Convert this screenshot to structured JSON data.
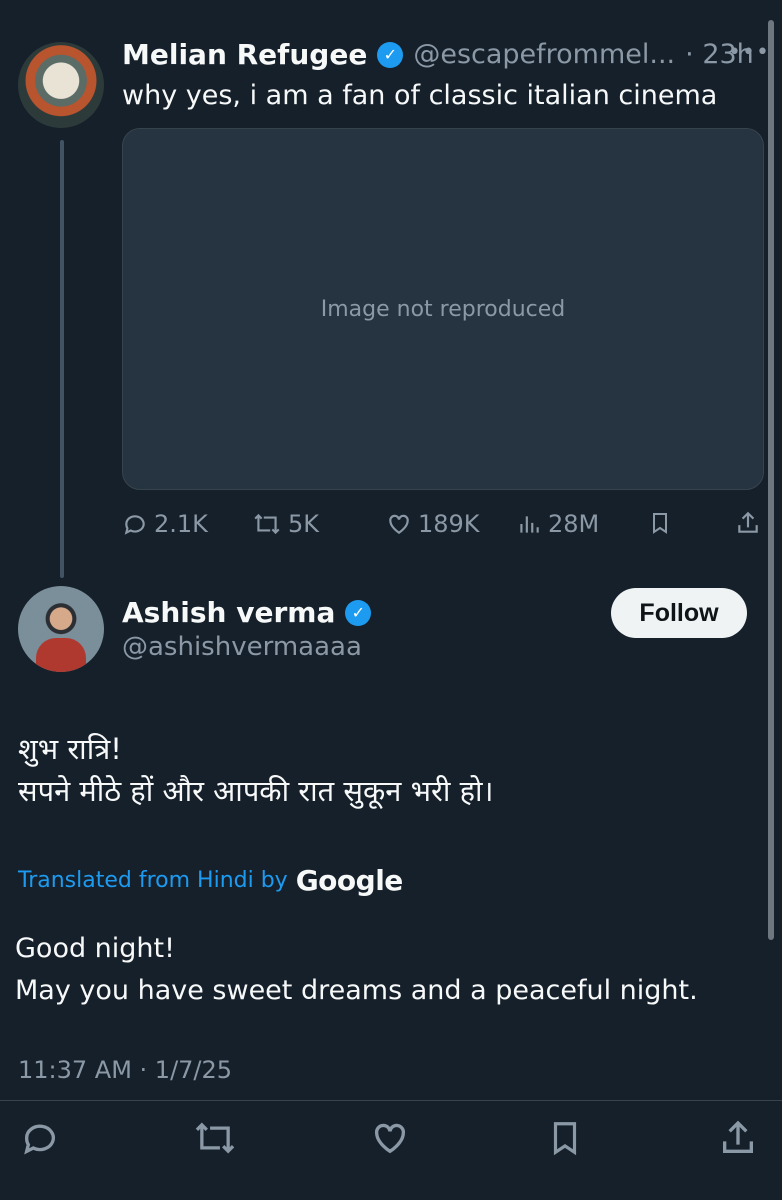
{
  "post1": {
    "name": "Melian Refugee",
    "handle": "@escapefrommel...",
    "age": "· 23h",
    "more": "•••",
    "text": "why yes, i am a fan of classic italian cinema",
    "media_note": "Image not reproduced",
    "stats": {
      "replies": "2.1K",
      "reposts": "5K",
      "likes": "189K",
      "views": "28M"
    }
  },
  "post2": {
    "name": "Ashish verma",
    "handle": "@ashishvermaaaa",
    "follow_label": "Follow",
    "hindi_text": "शुभ रात्रि!\nसपने मीठे हों और आपकी रात सुकून भरी हो।",
    "translated_label": "Translated from Hindi by",
    "translated_by": "Google",
    "english_text": "Good night!\nMay you have sweet dreams and a peaceful night.",
    "timestamp": "11:37 AM · 1/7/25"
  },
  "colors": {
    "background": "#15202b",
    "accent": "#1d9bf0",
    "muted": "#8b98a5"
  },
  "icons": [
    "verified-badge-icon",
    "reply-icon",
    "repost-icon",
    "like-icon",
    "views-icon",
    "bookmark-icon",
    "share-icon"
  ]
}
